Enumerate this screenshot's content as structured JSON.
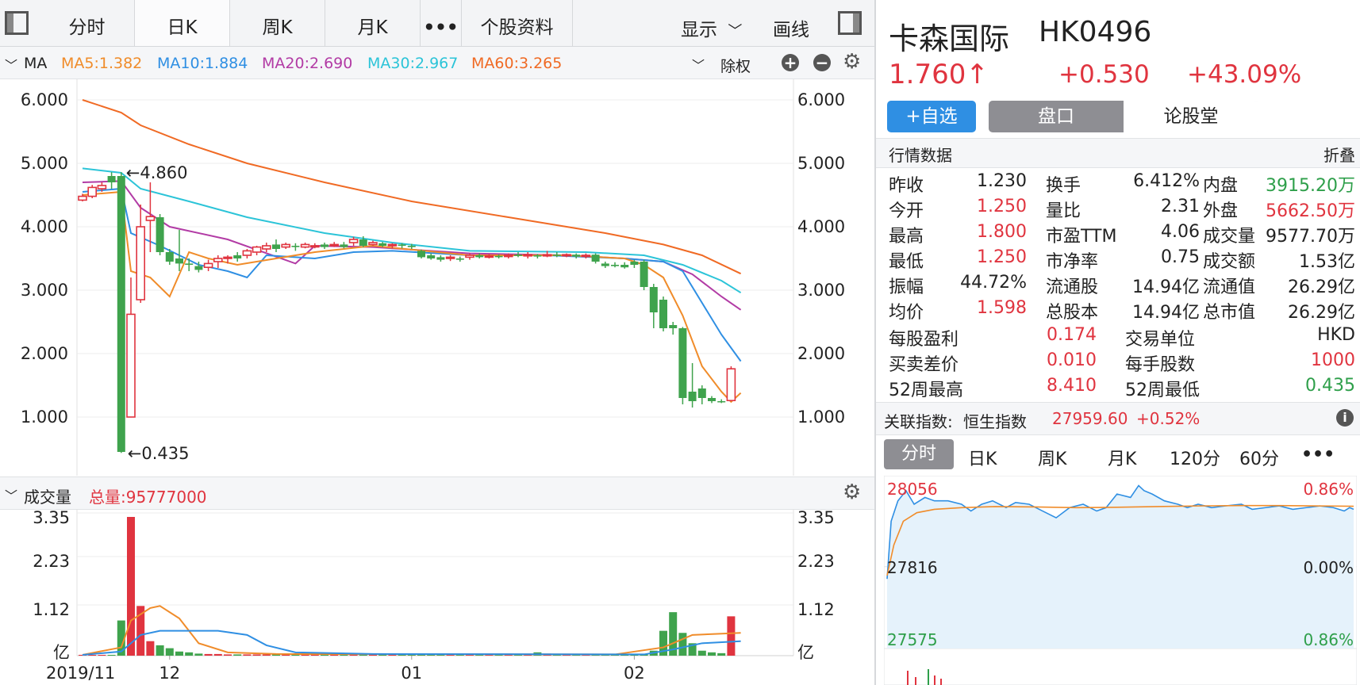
{
  "tabs": {
    "items": [
      "分时",
      "日K",
      "周K",
      "月K",
      "•••",
      "个股资料"
    ],
    "active": 1,
    "display_label": "显示",
    "draw_label": "画线"
  },
  "ma_bar": {
    "title": "MA",
    "ma5": "MA5:1.382",
    "ma10": "MA10:1.884",
    "ma20": "MA20:2.690",
    "ma30": "MA30:2.967",
    "ma60": "MA60:3.265",
    "adjust_label": "除权"
  },
  "volume_bar": {
    "title": "成交量",
    "total": "总量:95777000"
  },
  "colors": {
    "up": "#e0343f",
    "down": "#3fa34d",
    "ma5": "#f08c2a",
    "ma10": "#2f8fe3",
    "ma20": "#b23ba5",
    "ma30": "#2cc4d8",
    "ma60": "#f06a24",
    "accent_blue": "#2f8fe3"
  },
  "chart_data": [
    {
      "type": "candlestick",
      "y_ticks": [
        "6.000",
        "5.000",
        "4.000",
        "3.000",
        "2.000",
        "1.000"
      ],
      "ylim": [
        0.1,
        6.2
      ],
      "x_labels": [
        "2019/11",
        "12",
        "01",
        "02"
      ],
      "x_label_index": [
        -1,
        9,
        34,
        57
      ],
      "annotations": {
        "high": "←4.860",
        "low": "←0.435"
      },
      "candles": [
        [
          4.42,
          4.48,
          4.4,
          4.52
        ],
        [
          4.48,
          4.62,
          4.45,
          4.66
        ],
        [
          4.6,
          4.65,
          4.55,
          4.7
        ],
        [
          4.8,
          4.7,
          4.6,
          4.86
        ],
        [
          4.8,
          0.45,
          0.435,
          4.86
        ],
        [
          1.0,
          2.62,
          1.0,
          3.2
        ],
        [
          2.85,
          4.0,
          2.8,
          4.35
        ],
        [
          4.1,
          4.16,
          3.6,
          4.7
        ],
        [
          4.15,
          3.6,
          3.55,
          4.2
        ],
        [
          3.6,
          3.45,
          3.4,
          3.65
        ],
        [
          3.5,
          3.42,
          3.3,
          3.95
        ],
        [
          3.42,
          3.4,
          3.3,
          3.5
        ],
        [
          3.38,
          3.32,
          3.28,
          3.45
        ],
        [
          3.36,
          3.42,
          3.3,
          3.48
        ],
        [
          3.45,
          3.5,
          3.35,
          3.55
        ],
        [
          3.5,
          3.52,
          3.42,
          3.55
        ],
        [
          3.55,
          3.5,
          3.45,
          3.6
        ],
        [
          3.55,
          3.62,
          3.5,
          3.65
        ],
        [
          3.6,
          3.68,
          3.55,
          3.7
        ],
        [
          3.65,
          3.7,
          3.6,
          3.75
        ],
        [
          3.72,
          3.65,
          3.6,
          3.8
        ],
        [
          3.68,
          3.72,
          3.65,
          3.75
        ],
        [
          3.7,
          3.68,
          3.62,
          3.74
        ],
        [
          3.68,
          3.72,
          3.66,
          3.75
        ],
        [
          3.7,
          3.7,
          3.66,
          3.74
        ],
        [
          3.72,
          3.68,
          3.65,
          3.75
        ],
        [
          3.7,
          3.72,
          3.68,
          3.76
        ],
        [
          3.72,
          3.68,
          3.66,
          3.76
        ],
        [
          3.75,
          3.8,
          3.7,
          3.84
        ],
        [
          3.8,
          3.7,
          3.68,
          3.85
        ],
        [
          3.72,
          3.75,
          3.7,
          3.78
        ],
        [
          3.74,
          3.7,
          3.68,
          3.76
        ],
        [
          3.7,
          3.72,
          3.66,
          3.74
        ],
        [
          3.72,
          3.7,
          3.66,
          3.74
        ],
        [
          3.7,
          3.68,
          3.65,
          3.73
        ],
        [
          3.62,
          3.52,
          3.5,
          3.64
        ],
        [
          3.55,
          3.5,
          3.48,
          3.58
        ],
        [
          3.52,
          3.48,
          3.45,
          3.55
        ],
        [
          3.5,
          3.52,
          3.46,
          3.55
        ],
        [
          3.5,
          3.48,
          3.45,
          3.53
        ],
        [
          3.52,
          3.55,
          3.48,
          3.58
        ],
        [
          3.55,
          3.52,
          3.5,
          3.58
        ],
        [
          3.52,
          3.54,
          3.5,
          3.57
        ],
        [
          3.54,
          3.52,
          3.5,
          3.56
        ],
        [
          3.53,
          3.55,
          3.5,
          3.58
        ],
        [
          3.56,
          3.54,
          3.52,
          3.6
        ],
        [
          3.54,
          3.56,
          3.5,
          3.6
        ],
        [
          3.55,
          3.53,
          3.5,
          3.57
        ],
        [
          3.54,
          3.56,
          3.52,
          3.62
        ],
        [
          3.56,
          3.54,
          3.52,
          3.6
        ],
        [
          3.55,
          3.56,
          3.52,
          3.58
        ],
        [
          3.56,
          3.53,
          3.5,
          3.58
        ],
        [
          3.54,
          3.55,
          3.5,
          3.58
        ],
        [
          3.56,
          3.45,
          3.42,
          3.58
        ],
        [
          3.42,
          3.38,
          3.35,
          3.45
        ],
        [
          3.4,
          3.38,
          3.36,
          3.44
        ],
        [
          3.4,
          3.36,
          3.34,
          3.44
        ],
        [
          3.45,
          3.4,
          3.35,
          3.48
        ],
        [
          3.45,
          3.05,
          3.0,
          3.48
        ],
        [
          3.05,
          2.65,
          2.4,
          3.1
        ],
        [
          2.85,
          2.4,
          2.35,
          2.9
        ],
        [
          2.45,
          2.4,
          2.3,
          2.5
        ],
        [
          2.4,
          1.3,
          1.2,
          2.42
        ],
        [
          1.4,
          1.25,
          1.15,
          1.85
        ],
        [
          1.45,
          1.3,
          1.2,
          1.5
        ],
        [
          1.3,
          1.25,
          1.22,
          1.33
        ],
        [
          1.25,
          1.24,
          1.22,
          1.28
        ],
        [
          1.26,
          1.76,
          1.25,
          1.8
        ]
      ],
      "ma_lines": {
        "ma60": [
          [
            0,
            6.0
          ],
          [
            4,
            5.8
          ],
          [
            6,
            5.6
          ],
          [
            11,
            5.3
          ],
          [
            17,
            5.0
          ],
          [
            25,
            4.7
          ],
          [
            34,
            4.4
          ],
          [
            44,
            4.15
          ],
          [
            54,
            3.9
          ],
          [
            60,
            3.72
          ],
          [
            64,
            3.55
          ],
          [
            68,
            3.26
          ]
        ],
        "ma30": [
          [
            0,
            4.92
          ],
          [
            4,
            4.85
          ],
          [
            6,
            4.6
          ],
          [
            11,
            4.4
          ],
          [
            17,
            4.15
          ],
          [
            25,
            3.9
          ],
          [
            32,
            3.75
          ],
          [
            40,
            3.62
          ],
          [
            52,
            3.6
          ],
          [
            58,
            3.55
          ],
          [
            62,
            3.4
          ],
          [
            66,
            3.15
          ],
          [
            68,
            2.96
          ]
        ],
        "ma20": [
          [
            0,
            4.7
          ],
          [
            4,
            4.72
          ],
          [
            6,
            4.3
          ],
          [
            9,
            4.0
          ],
          [
            15,
            3.8
          ],
          [
            22,
            3.42
          ],
          [
            24,
            3.7
          ],
          [
            30,
            3.68
          ],
          [
            40,
            3.58
          ],
          [
            50,
            3.55
          ],
          [
            56,
            3.5
          ],
          [
            60,
            3.45
          ],
          [
            63,
            3.25
          ],
          [
            66,
            2.9
          ],
          [
            68,
            2.69
          ]
        ],
        "ma10": [
          [
            0,
            4.55
          ],
          [
            4,
            4.6
          ],
          [
            5,
            3.9
          ],
          [
            8,
            3.7
          ],
          [
            12,
            3.4
          ],
          [
            15,
            3.3
          ],
          [
            17,
            3.2
          ],
          [
            19,
            3.55
          ],
          [
            24,
            3.5
          ],
          [
            28,
            3.6
          ],
          [
            32,
            3.62
          ],
          [
            40,
            3.55
          ],
          [
            48,
            3.55
          ],
          [
            56,
            3.5
          ],
          [
            60,
            3.45
          ],
          [
            62,
            3.3
          ],
          [
            64,
            2.8
          ],
          [
            66,
            2.3
          ],
          [
            68,
            1.88
          ]
        ],
        "ma5": [
          [
            0,
            4.5
          ],
          [
            4,
            4.55
          ],
          [
            5,
            3.3
          ],
          [
            7,
            3.2
          ],
          [
            9,
            2.9
          ],
          [
            11,
            3.6
          ],
          [
            13,
            3.5
          ],
          [
            16,
            3.4
          ],
          [
            20,
            3.5
          ],
          [
            24,
            3.6
          ],
          [
            30,
            3.7
          ],
          [
            40,
            3.55
          ],
          [
            50,
            3.55
          ],
          [
            56,
            3.5
          ],
          [
            58,
            3.4
          ],
          [
            60,
            3.2
          ],
          [
            62,
            2.6
          ],
          [
            64,
            1.8
          ],
          [
            66,
            1.4
          ],
          [
            67,
            1.24
          ],
          [
            68,
            1.38
          ]
        ]
      }
    },
    {
      "type": "bar",
      "title": "成交量",
      "y_ticks": [
        "3.35",
        "2.23",
        "1.12",
        "亿"
      ],
      "ylim": [
        0,
        3.35
      ],
      "values": [
        0.02,
        0.02,
        0.02,
        0.02,
        0.85,
        3.35,
        1.2,
        0.35,
        0.25,
        0.18,
        0.1,
        0.08,
        0.05,
        0.04,
        0.04,
        0.03,
        0.03,
        0.03,
        0.03,
        0.03,
        0.03,
        0.03,
        0.03,
        0.03,
        0.03,
        0.03,
        0.03,
        0.03,
        0.03,
        0.03,
        0.03,
        0.03,
        0.03,
        0.03,
        0.03,
        0.03,
        0.03,
        0.03,
        0.03,
        0.03,
        0.03,
        0.03,
        0.03,
        0.03,
        0.03,
        0.03,
        0.03,
        0.08,
        0.05,
        0.03,
        0.03,
        0.03,
        0.03,
        0.03,
        0.03,
        0.03,
        0.03,
        0.03,
        0.03,
        0.12,
        0.6,
        1.05,
        0.55,
        0.3,
        0.12,
        0.08,
        0.06,
        0.95
      ],
      "ma_lines": {
        "vma5": [
          [
            0,
            0.02
          ],
          [
            4,
            0.2
          ],
          [
            5,
            0.85
          ],
          [
            7,
            1.15
          ],
          [
            8,
            1.2
          ],
          [
            10,
            0.9
          ],
          [
            12,
            0.3
          ],
          [
            15,
            0.08
          ],
          [
            20,
            0.04
          ],
          [
            55,
            0.03
          ],
          [
            60,
            0.2
          ],
          [
            63,
            0.5
          ],
          [
            68,
            0.55
          ]
        ],
        "vma10": [
          [
            0,
            0.02
          ],
          [
            4,
            0.1
          ],
          [
            6,
            0.5
          ],
          [
            8,
            0.6
          ],
          [
            14,
            0.6
          ],
          [
            17,
            0.5
          ],
          [
            19,
            0.25
          ],
          [
            22,
            0.08
          ],
          [
            30,
            0.04
          ],
          [
            58,
            0.03
          ],
          [
            61,
            0.15
          ],
          [
            64,
            0.3
          ],
          [
            68,
            0.35
          ]
        ]
      }
    },
    {
      "type": "line",
      "labels": {
        "max": "28056",
        "base": "27816",
        "min": "27575",
        "pct_top": "0.86%",
        "pct_mid": "0.00%",
        "pct_bot": "0.86%"
      },
      "price_line": [
        [
          0,
          27780
        ],
        [
          3,
          27950
        ],
        [
          8,
          28010
        ],
        [
          14,
          28040
        ],
        [
          20,
          28000
        ],
        [
          28,
          28020
        ],
        [
          35,
          28010
        ],
        [
          45,
          28010
        ],
        [
          55,
          28000
        ],
        [
          62,
          27980
        ],
        [
          70,
          28000
        ],
        [
          78,
          28010
        ],
        [
          88,
          27990
        ],
        [
          95,
          28005
        ],
        [
          105,
          28000
        ],
        [
          115,
          27980
        ],
        [
          125,
          27960
        ],
        [
          135,
          27990
        ],
        [
          145,
          28000
        ],
        [
          155,
          27980
        ],
        [
          162,
          27990
        ],
        [
          170,
          28030
        ],
        [
          180,
          28020
        ],
        [
          186,
          28055
        ],
        [
          190,
          28040
        ],
        [
          196,
          28030
        ],
        [
          205,
          28010
        ],
        [
          215,
          28000
        ],
        [
          222,
          27990
        ],
        [
          230,
          28000
        ],
        [
          240,
          27990
        ],
        [
          250,
          27995
        ],
        [
          262,
          28000
        ],
        [
          270,
          27985
        ],
        [
          280,
          27990
        ],
        [
          290,
          27995
        ],
        [
          300,
          27985
        ],
        [
          310,
          27990
        ],
        [
          320,
          27995
        ],
        [
          330,
          27990
        ],
        [
          338,
          27980
        ],
        [
          342,
          27990
        ],
        [
          345,
          27985
        ]
      ],
      "avg_line": [
        [
          0,
          27790
        ],
        [
          5,
          27880
        ],
        [
          12,
          27950
        ],
        [
          22,
          27975
        ],
        [
          35,
          27985
        ],
        [
          55,
          27990
        ],
        [
          80,
          27993
        ],
        [
          110,
          27992
        ],
        [
          140,
          27990
        ],
        [
          170,
          27991
        ],
        [
          200,
          27993
        ],
        [
          230,
          27995
        ],
        [
          260,
          27996
        ],
        [
          290,
          27996
        ],
        [
          320,
          27995
        ],
        [
          345,
          27994
        ]
      ]
    }
  ],
  "stock": {
    "name": "卡森国际",
    "code": "HK0496",
    "price": "1.760",
    "arrow": "↑",
    "change": "+0.530",
    "change_pct": "+43.09%"
  },
  "buttons": {
    "watchlist": "+自选",
    "order_book": "盘口",
    "forum": "论股堂"
  },
  "market_header": {
    "title": "行情数据",
    "collapse": "折叠"
  },
  "quote_grid": [
    [
      [
        "昨收",
        "1.230",
        "black"
      ],
      [
        "换手",
        "6.412%",
        "black"
      ],
      [
        "内盘",
        "3915.20万",
        "green"
      ]
    ],
    [
      [
        "今开",
        "1.250",
        "red"
      ],
      [
        "量比",
        "2.31",
        "black"
      ],
      [
        "外盘",
        "5662.50万",
        "red"
      ]
    ],
    [
      [
        "最高",
        "1.800",
        "red"
      ],
      [
        "市盈TTM",
        "4.06",
        "black"
      ],
      [
        "成交量",
        "9577.70万",
        "black"
      ]
    ],
    [
      [
        "最低",
        "1.250",
        "red"
      ],
      [
        "市净率",
        "0.75",
        "black"
      ],
      [
        "成交额",
        "1.53亿",
        "black"
      ]
    ],
    [
      [
        "振幅",
        "44.72%",
        "black"
      ],
      [
        "流通股",
        "14.94亿",
        "black"
      ],
      [
        "流通值",
        "26.29亿",
        "black"
      ]
    ],
    [
      [
        "均价",
        "1.598",
        "red"
      ],
      [
        "总股本",
        "14.94亿",
        "black"
      ],
      [
        "总市值",
        "26.29亿",
        "black"
      ]
    ]
  ],
  "quote_grid2": [
    [
      [
        "每股盈利",
        "0.174",
        "red"
      ],
      [
        "交易单位",
        "HKD",
        "black"
      ]
    ],
    [
      [
        "买卖差价",
        "0.010",
        "red"
      ],
      [
        "每手股数",
        "1000",
        "red"
      ]
    ],
    [
      [
        "52周最高",
        "8.410",
        "red"
      ],
      [
        "52周最低",
        "0.435",
        "green"
      ]
    ]
  ],
  "related_index": {
    "label": "关联指数:",
    "name": "恒生指数",
    "value": "27959.60",
    "change": "+0.52%"
  },
  "mini_tabs": {
    "items": [
      "分时",
      "日K",
      "周K",
      "月K",
      "120分",
      "60分",
      "•••"
    ],
    "active": 0
  }
}
